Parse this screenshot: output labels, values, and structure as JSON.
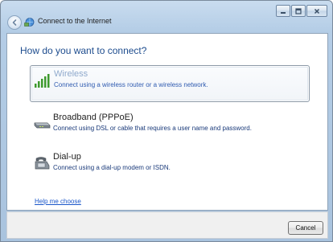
{
  "window": {
    "title": "Connect to the Internet",
    "back_icon": "back-arrow-icon",
    "caption_buttons": [
      "minimize",
      "maximize",
      "close"
    ]
  },
  "main": {
    "heading": "How do you want to connect?",
    "options": [
      {
        "title": "Wireless",
        "description": "Connect using a wireless router or a wireless network.",
        "icon": "wireless-signal-icon",
        "selected": true
      },
      {
        "title": "Broadband (PPPoE)",
        "description": "Connect using DSL or cable that requires a user name and password.",
        "icon": "broadband-modem-icon",
        "selected": false
      },
      {
        "title": "Dial-up",
        "description": "Connect using a dial-up modem or ISDN.",
        "icon": "dialup-phone-icon",
        "selected": false
      }
    ],
    "help_link": "Help me choose"
  },
  "footer": {
    "cancel_label": "Cancel"
  },
  "colors": {
    "heading": "#1d4c8e",
    "link": "#1a56c9",
    "selected_title": "#8fa9cc",
    "window_frame": "#b4cde6"
  }
}
